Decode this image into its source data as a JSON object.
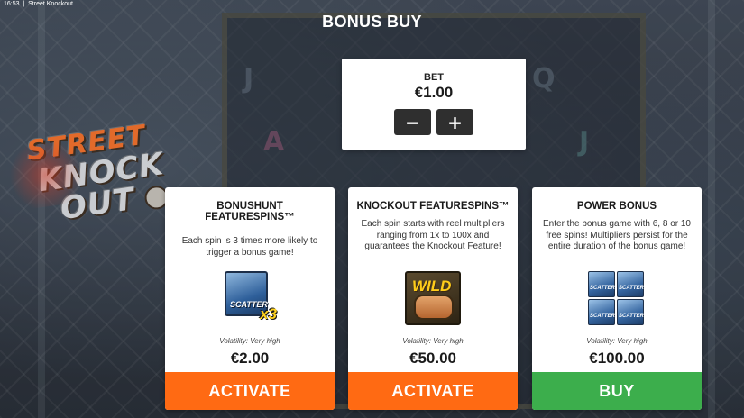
{
  "status_bar": {
    "time": "16:53",
    "app_title": "Street Knockout"
  },
  "logo": {
    "line1": "STREET",
    "line2": "KNOCK",
    "line3": "OUT"
  },
  "title": "BONUS BUY",
  "bet": {
    "label": "BET",
    "value": "€1.00",
    "decrease_symbol": "−",
    "increase_symbol": "+"
  },
  "cards": [
    {
      "title": "BONUSHUNT FEATURESPINS™",
      "description": "Each spin is 3 times more likely to trigger a bonus game!",
      "icon": "scatter-x3-icon",
      "icon_text": "SCATTER",
      "icon_multiplier": "x3",
      "volatility": "Volatility: Very high",
      "price": "€2.00",
      "action": "ACTIVATE",
      "action_color": "#ff6a13"
    },
    {
      "title": "KNOCKOUT FEATURESPINS™",
      "description": "Each spin starts with reel multipliers ranging from 1x to 100x and guarantees the Knockout Feature!",
      "icon": "wild-fist-icon",
      "icon_text": "WILD",
      "volatility": "Volatility: Very high",
      "price": "€50.00",
      "action": "ACTIVATE",
      "action_color": "#ff6a13"
    },
    {
      "title": "POWER BONUS",
      "description": "Enter the bonus game with 6, 8 or 10 free spins! Multipliers persist for the entire duration of the bonus game!",
      "icon": "scatter-grid-icon",
      "icon_text": "SCATTER",
      "volatility": "Volatility: Very high",
      "price": "€100.00",
      "action": "BUY",
      "action_color": "#3cae4c"
    }
  ],
  "colors": {
    "activate": "#ff6a13",
    "buy": "#3cae4c",
    "panel": "#ffffff"
  }
}
